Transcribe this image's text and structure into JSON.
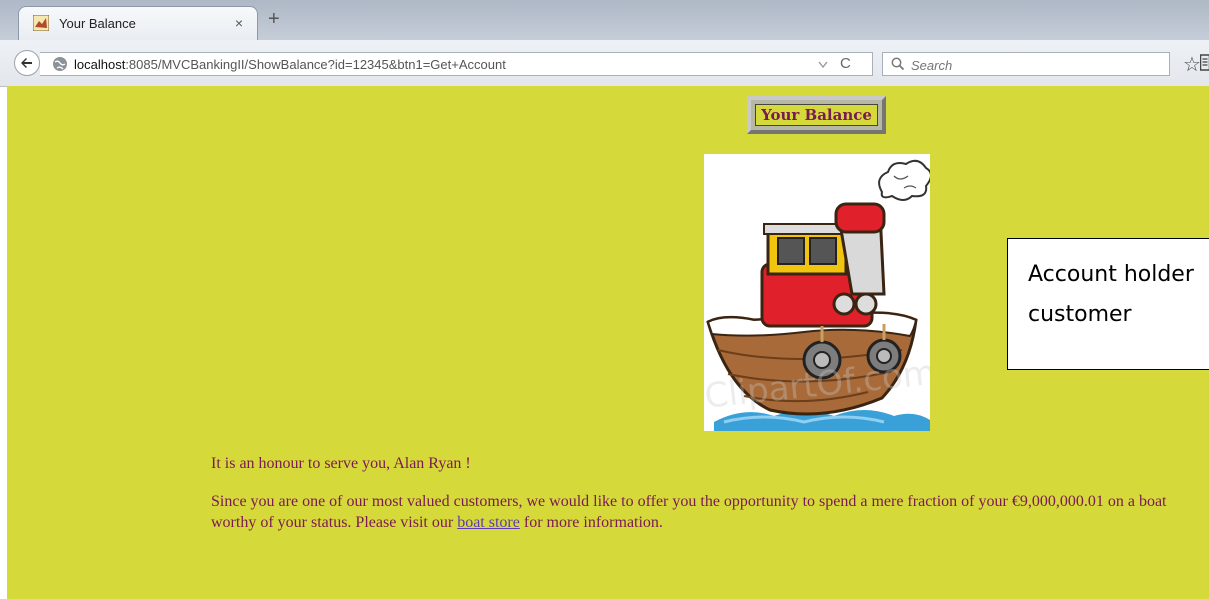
{
  "browser": {
    "tab_title": "Your Balance",
    "tab_close": "×",
    "new_tab": "+",
    "url_host": "localhost",
    "url_path": ":8085/MVCBankingII/ShowBalance?id=12345&btn1=Get+Account",
    "search_placeholder": "Search",
    "reload_glyph": "C",
    "star_glyph": "☆"
  },
  "page": {
    "balance_button": "Your Balance",
    "image_watermark": "ClipartOf.com",
    "callout_text": "Account holder\ncustomer",
    "greeting": "It is an honour to serve you, Alan Ryan !",
    "offer_before": "Since you are one of our most valued customers, we would like to offer you the opportunity to spend a mere fraction of your €9,000,000.01 on a boat worthy of your status. Please visit our ",
    "offer_link": "boat store",
    "offer_after": " for more information."
  },
  "colors": {
    "page_background": "#d6d93a",
    "text": "#7a1a52",
    "link": "#5e3bb0"
  }
}
